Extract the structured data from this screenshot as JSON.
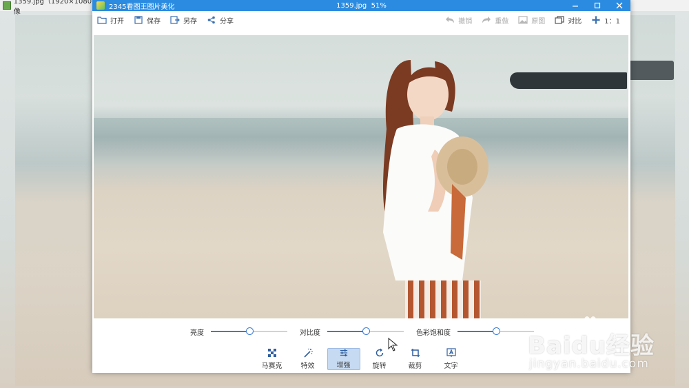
{
  "background_viewer": {
    "title": "1359.jpg（1920×1080像"
  },
  "editor": {
    "app_name": "2345看图王图片美化",
    "file_title": "1359.jpg",
    "zoom": "51%",
    "toolbar": {
      "open": "打开",
      "save": "保存",
      "save_as": "另存",
      "share": "分享",
      "undo": "撤销",
      "redo": "重做",
      "original": "原图",
      "compare": "对比",
      "actual_size": "1：1"
    },
    "sliders": [
      {
        "label": "亮度",
        "value": 0.5
      },
      {
        "label": "对比度",
        "value": 0.5
      },
      {
        "label": "色彩饱和度",
        "value": 0.5
      }
    ],
    "tools": [
      {
        "label": "马赛克",
        "icon": "mosaic-icon",
        "active": false
      },
      {
        "label": "特效",
        "icon": "magic-wand-icon",
        "active": false
      },
      {
        "label": "增强",
        "icon": "sliders-icon",
        "active": true
      },
      {
        "label": "旋转",
        "icon": "rotate-icon",
        "active": false
      },
      {
        "label": "裁剪",
        "icon": "crop-icon",
        "active": false
      },
      {
        "label": "文字",
        "icon": "text-icon",
        "active": false
      }
    ],
    "colors": {
      "titlebar": "#2b8be0",
      "accent": "#3a7bd5",
      "active_tool_bg": "#c6daf2"
    }
  },
  "watermark": {
    "brand": "Baidu经验",
    "url": "jingyan.baidu.com"
  }
}
